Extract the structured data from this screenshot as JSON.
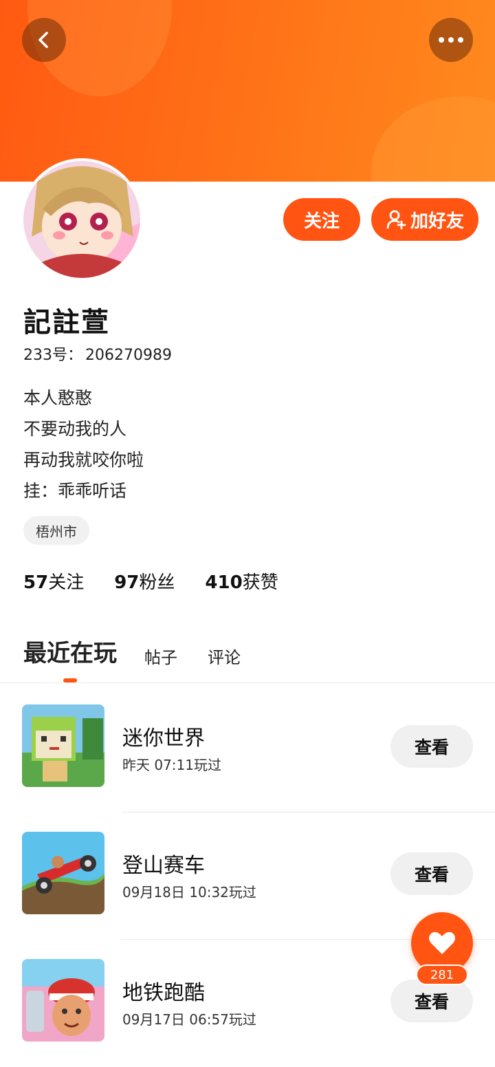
{
  "profile": {
    "username": "記註萱",
    "id_label": "233号：",
    "id_value": "206270989",
    "bio_lines": [
      "本人憨憨",
      "不要动我的人",
      "再动我就咬你啦",
      "挂：乖乖听话"
    ],
    "location": "梧州市"
  },
  "actions": {
    "follow_label": "关注",
    "add_friend_label": "加好友"
  },
  "stats": {
    "following_count": "57",
    "following_label": "关注",
    "fans_count": "97",
    "fans_label": "粉丝",
    "likes_count": "410",
    "likes_label": "获赞"
  },
  "tabs": [
    {
      "label": "最近在玩",
      "active": true
    },
    {
      "label": "帖子",
      "active": false
    },
    {
      "label": "评论",
      "active": false
    }
  ],
  "games": [
    {
      "name": "迷你世界",
      "time": "昨天 07:11玩过",
      "view_label": "查看"
    },
    {
      "name": "登山赛车",
      "time": "09月18日 10:32玩过",
      "view_label": "查看"
    },
    {
      "name": "地铁跑酷",
      "time": "09月17日 06:57玩过",
      "view_label": "查看"
    }
  ],
  "like_fab": {
    "count": "281"
  },
  "icons": {
    "back": "chevron-left-icon",
    "more": "more-dots-icon",
    "add_friend": "user-plus-icon",
    "like": "heart-icon"
  },
  "colors": {
    "accent": "#ff5412",
    "header_gradient_start": "#ff5a12",
    "header_gradient_end": "#ff8a1e"
  }
}
